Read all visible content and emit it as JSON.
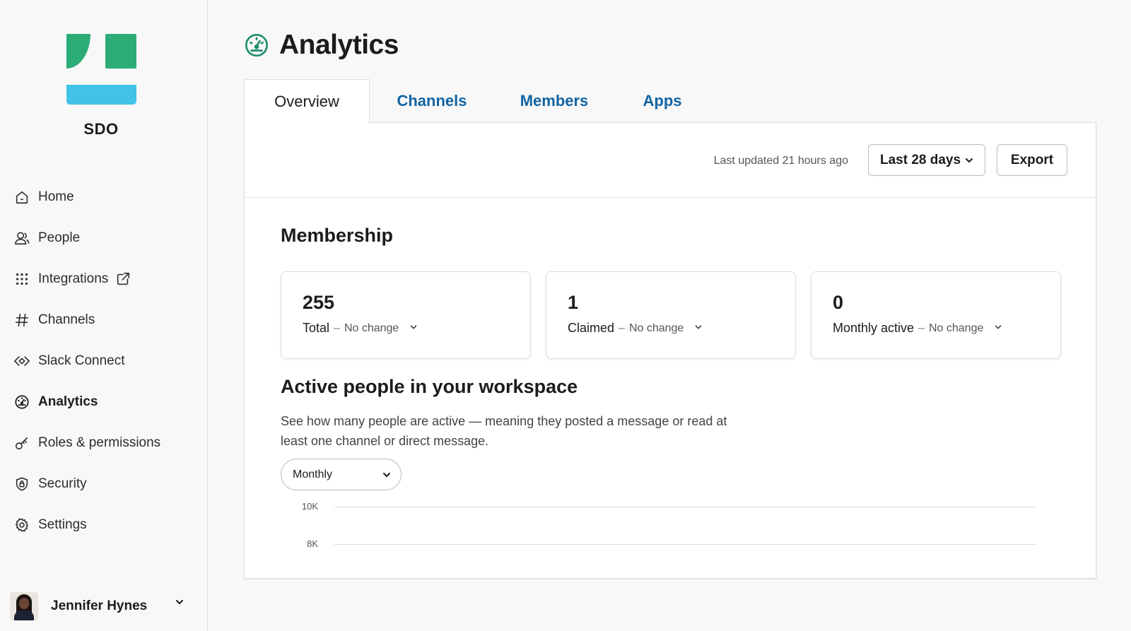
{
  "workspace": {
    "name": "SDO",
    "logo_colors": {
      "green": "#2bac76",
      "blue": "#41c2e6"
    }
  },
  "sidebar": {
    "items": [
      {
        "label": "Home",
        "icon": "home-icon"
      },
      {
        "label": "People",
        "icon": "people-icon"
      },
      {
        "label": "Integrations",
        "icon": "grid-dots-icon",
        "external": "external-link-icon"
      },
      {
        "label": "Channels",
        "icon": "hash-icon"
      },
      {
        "label": "Slack Connect",
        "icon": "slack-connect-icon"
      },
      {
        "label": "Analytics",
        "icon": "gauge-icon",
        "active": true
      },
      {
        "label": "Roles & permissions",
        "icon": "key-icon"
      },
      {
        "label": "Security",
        "icon": "shield-icon"
      },
      {
        "label": "Settings",
        "icon": "gear-icon"
      }
    ],
    "user": {
      "name": "Jennifer Hynes"
    }
  },
  "page": {
    "title": "Analytics",
    "title_icon_color": "#1f8e6e"
  },
  "tabs": [
    {
      "label": "Overview",
      "active": true
    },
    {
      "label": "Channels"
    },
    {
      "label": "Members"
    },
    {
      "label": "Apps"
    }
  ],
  "toolbar": {
    "last_updated": "Last updated 21 hours ago",
    "range": "Last 28 days",
    "export": "Export"
  },
  "membership": {
    "title": "Membership",
    "cards": [
      {
        "value": "255",
        "label": "Total",
        "sep": "–",
        "change": "No change"
      },
      {
        "value": "1",
        "label": "Claimed",
        "sep": "–",
        "change": "No change"
      },
      {
        "value": "0",
        "label": "Monthly active",
        "sep": "–",
        "change": "No change"
      }
    ]
  },
  "active_people": {
    "title": "Active people in your workspace",
    "description": "See how many people are active — meaning they posted a message or read at least one channel or direct message.",
    "period": "Monthly",
    "y_ticks": [
      "10K",
      "8K"
    ]
  },
  "colors": {
    "link": "#1264a3",
    "text": "#1d1c1d",
    "border": "#dddddd"
  }
}
